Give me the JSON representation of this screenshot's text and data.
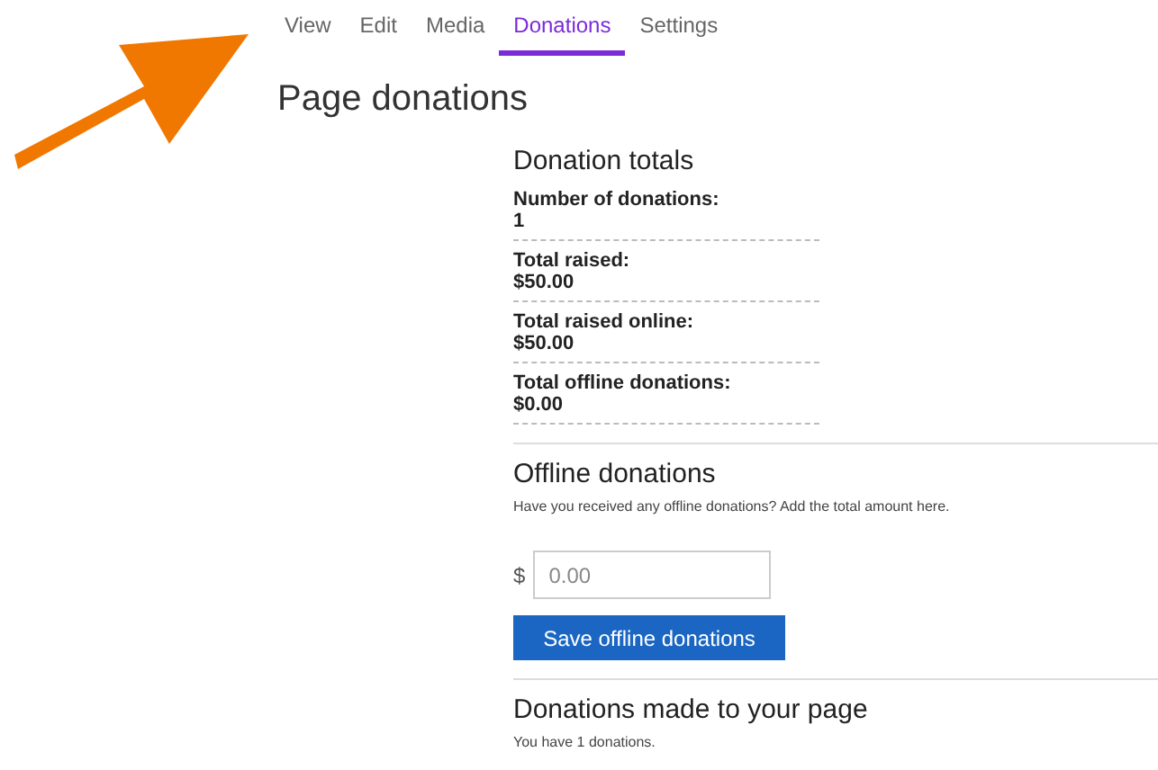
{
  "tabs": [
    {
      "label": "View",
      "selected": false
    },
    {
      "label": "Edit",
      "selected": false
    },
    {
      "label": "Media",
      "selected": false
    },
    {
      "label": "Donations",
      "selected": true
    },
    {
      "label": "Settings",
      "selected": false
    }
  ],
  "page_title": "Page donations",
  "donation_totals": {
    "heading": "Donation totals",
    "items": [
      {
        "label": "Number of donations:",
        "value": "1"
      },
      {
        "label": "Total raised:",
        "value": "$50.00"
      },
      {
        "label": "Total raised online:",
        "value": "$50.00"
      },
      {
        "label": "Total offline donations:",
        "value": "$0.00"
      }
    ]
  },
  "offline_donations": {
    "heading": "Offline donations",
    "description": "Have you received any offline donations? Add the total amount here.",
    "currency": "$",
    "placeholder": "0.00",
    "button": "Save offline donations"
  },
  "donations_made": {
    "heading": "Donations made to your page",
    "text": "You have 1 donations."
  }
}
